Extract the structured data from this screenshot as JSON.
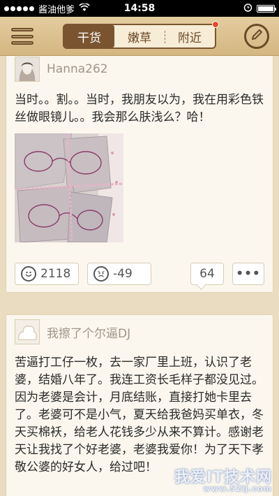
{
  "status_bar": {
    "carrier": "酱油他爹",
    "time": "14:58",
    "battery_level": 1.0
  },
  "nav": {
    "tabs": [
      {
        "label": "干货",
        "active": true
      },
      {
        "label": "嫩草",
        "active": false
      },
      {
        "label": "附近",
        "active": false,
        "badge": true
      }
    ]
  },
  "posts": [
    {
      "username": "Hanna262",
      "text": "当时。。割。。当时，我朋友以为，我在用彩色铁丝做眼镜儿。。我会那么肤浅么？哈！",
      "up_count": "2118",
      "down_count": "-49",
      "comment_count": "64",
      "more_label": "•••"
    },
    {
      "username": "我擦了个尔逼DJ",
      "text": "苦逼打工仔一枚，去一家厂里上班，认识了老婆，结婚八年了。我连工资长毛样子都没见过。因为老婆是会计，月底结账，直接打她卡里去了。老婆可不是小气，夏天给我爸妈买单衣，冬天买棉袄，给老人花钱多少从来不算计。感谢老天让我找了个好老婆，老婆我爱你！为了天下孝敬公婆的好女人，给过吧！"
    }
  ],
  "watermark": {
    "text": "我爱IT技术网",
    "sub": "www.52ij.com"
  },
  "colors": {
    "nav_bg": "#d9bd8a",
    "tab_active": "#7a5430",
    "badge": "#e64a2e",
    "card_bg": "#fbf7ee"
  }
}
